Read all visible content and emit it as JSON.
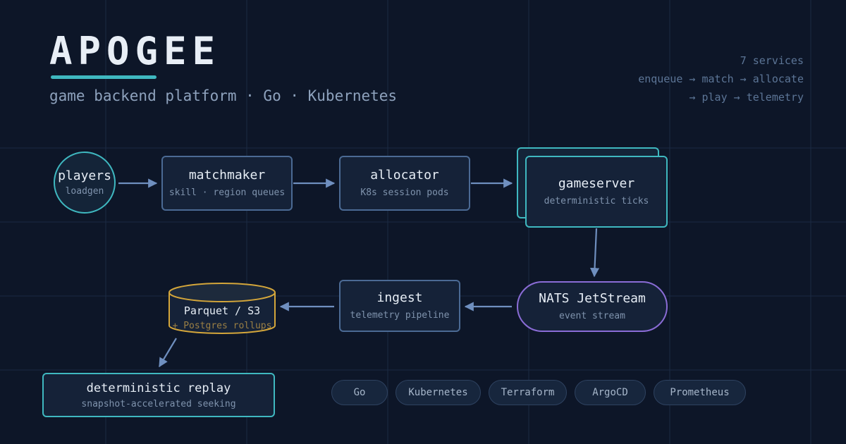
{
  "header": {
    "title": "APOGEE",
    "subtitle": "game backend platform · Go · Kubernetes"
  },
  "meta": {
    "line1": "7 services",
    "line2": "enqueue → match → allocate",
    "line3": "→ play → telemetry"
  },
  "nodes": {
    "players": {
      "title": "players",
      "sub": "loadgen"
    },
    "matchmaker": {
      "title": "matchmaker",
      "sub": "skill · region queues"
    },
    "allocator": {
      "title": "allocator",
      "sub": "K8s session pods"
    },
    "gameserver": {
      "title": "gameserver",
      "sub": "deterministic ticks"
    },
    "nats": {
      "title": "NATS JetStream",
      "sub": "event stream"
    },
    "ingest": {
      "title": "ingest",
      "sub": "telemetry pipeline"
    },
    "storage": {
      "title": "Parquet / S3",
      "sub": "+ Postgres rollups"
    },
    "replay": {
      "title": "deterministic replay",
      "sub": "snapshot-accelerated seeking"
    }
  },
  "tags": [
    "Go",
    "Kubernetes",
    "Terraform",
    "ArgoCD",
    "Prometheus"
  ],
  "colors": {
    "background": "#0d1628",
    "node_border": "#4b6a94",
    "accent_teal": "#3fb8c0",
    "accent_purple": "#8a6cd6",
    "storage_gold": "#d4a63a",
    "arrow": "#6f8fbf"
  }
}
